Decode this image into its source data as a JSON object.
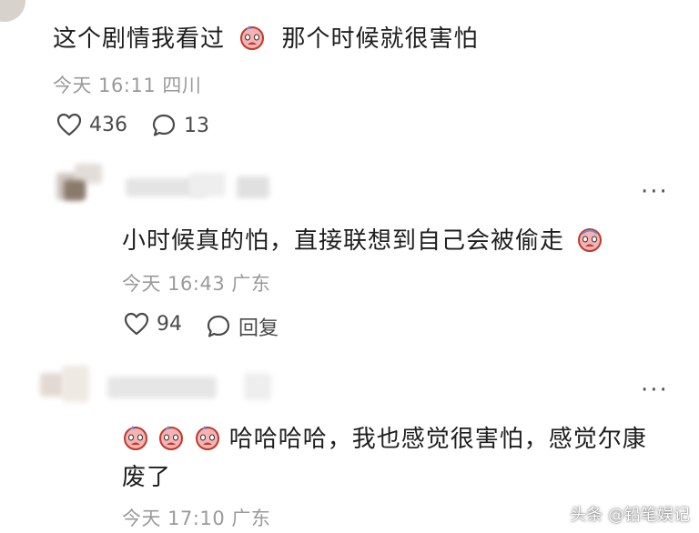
{
  "comment1": {
    "text_a": "这个剧情我看过",
    "text_b": "那个时候就很害怕",
    "meta": "今天 16:11 四川",
    "likes": "436",
    "replies": "13"
  },
  "reply1": {
    "text": "小时候真的怕，直接联想到自己会被偷走",
    "meta": "今天 16:43 广东",
    "likes": "94",
    "reply_label": "回复",
    "more": "···"
  },
  "reply2": {
    "text_line1": "哈哈哈哈，我也感觉很害怕，感觉尔康",
    "text_line2": "废了",
    "meta": "今天 17:10 广东",
    "more": "···"
  },
  "watermark": "头条 @铅笔娱记",
  "colors": {
    "text": "#1e1e1e",
    "meta": "#9a9a9a",
    "emoji_face": "#f3a9a9",
    "emoji_outline": "#c0392b"
  },
  "icons": {
    "like": "heart-outline-icon",
    "comment": "speech-bubble-icon",
    "more": "ellipsis-icon",
    "emoji": "scared-crying-face-emoji"
  }
}
